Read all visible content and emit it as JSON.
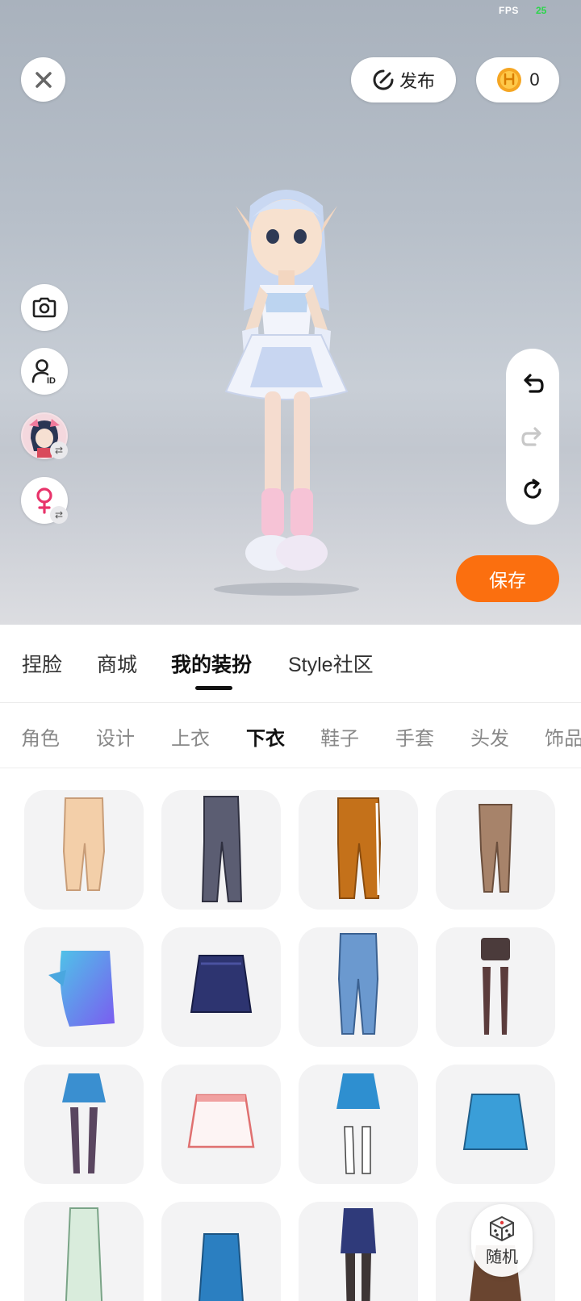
{
  "status": {
    "fps_label": "FPS",
    "fps_value": "25"
  },
  "header": {
    "close_icon": "close-icon",
    "publish_label": "发布",
    "coin_count": "0"
  },
  "side_tools": [
    "camera-icon",
    "user-id-icon",
    "avatar-swap",
    "gender-female-icon"
  ],
  "history": [
    "undo-icon",
    "redo-icon",
    "reset-icon"
  ],
  "save_label": "保存",
  "main_tabs": [
    {
      "label": "捏脸"
    },
    {
      "label": "商城"
    },
    {
      "label": "我的装扮",
      "active": true
    },
    {
      "label": "Style社区"
    }
  ],
  "sub_tabs": [
    {
      "label": "角色"
    },
    {
      "label": "设计"
    },
    {
      "label": "上衣"
    },
    {
      "label": "下衣",
      "active": true
    },
    {
      "label": "鞋子"
    },
    {
      "label": "手套"
    },
    {
      "label": "头发"
    },
    {
      "label": "饰品"
    }
  ],
  "items": [
    "beige-slit-skirt",
    "gray-flare-jeans",
    "orange-track-pants",
    "brown-leggings",
    "blue-sarong-skirt",
    "navy-pleated-skirt",
    "light-blue-jeans",
    "shorts-with-stockings",
    "blue-skirt-with-stockings",
    "white-pleated-skirt",
    "blue-skirt-white-socks",
    "blue-pleated-skirt",
    "green-long-skirt",
    "blue-pencil-skirt",
    "denim-skirt-tights",
    "brown-skirt"
  ],
  "random": {
    "icon": "dice-icon",
    "label": "随机"
  },
  "colors": {
    "accent": "#fb6f0f",
    "coin": "#f5a623"
  }
}
